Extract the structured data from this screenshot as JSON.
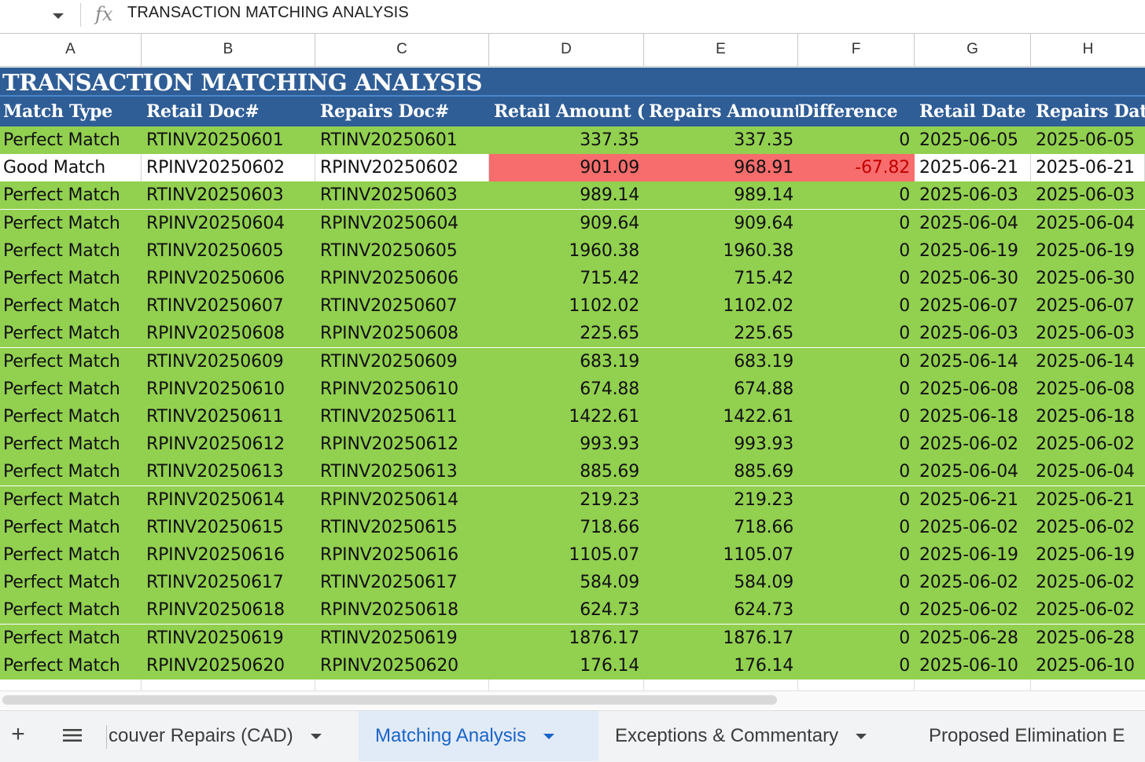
{
  "formula_bar": {
    "formula": "TRANSACTION MATCHING ANALYSIS"
  },
  "column_letters": [
    "A",
    "B",
    "C",
    "D",
    "E",
    "F",
    "G",
    "H"
  ],
  "sheet": {
    "title": "TRANSACTION MATCHING ANALYSIS",
    "headers": [
      "Match Type",
      "Retail Doc#",
      "Repairs Doc#",
      "Retail Amount (",
      "Repairs Amount",
      "Difference",
      "Retail Date",
      "Repairs Date"
    ],
    "rows": [
      {
        "type": "Perfect Match",
        "retail_doc": "RTINV20250601",
        "repairs_doc": "RTINV20250601",
        "retail_amt": "337.35",
        "repairs_amt": "337.35",
        "diff": "0",
        "retail_date": "2025-06-05",
        "repairs_date": "2025-06-05"
      },
      {
        "type": "Good Match",
        "retail_doc": "RPINV20250602",
        "repairs_doc": "RPINV20250602",
        "retail_amt": "901.09",
        "repairs_amt": "968.91",
        "diff": "-67.82",
        "retail_date": "2025-06-21",
        "repairs_date": "2025-06-21"
      },
      {
        "type": "Perfect Match",
        "retail_doc": "RTINV20250603",
        "repairs_doc": "RTINV20250603",
        "retail_amt": "989.14",
        "repairs_amt": "989.14",
        "diff": "0",
        "retail_date": "2025-06-03",
        "repairs_date": "2025-06-03"
      },
      {
        "type": "Perfect Match",
        "retail_doc": "RPINV20250604",
        "repairs_doc": "RPINV20250604",
        "retail_amt": "909.64",
        "repairs_amt": "909.64",
        "diff": "0",
        "retail_date": "2025-06-04",
        "repairs_date": "2025-06-04"
      },
      {
        "type": "Perfect Match",
        "retail_doc": "RTINV20250605",
        "repairs_doc": "RTINV20250605",
        "retail_amt": "1960.38",
        "repairs_amt": "1960.38",
        "diff": "0",
        "retail_date": "2025-06-19",
        "repairs_date": "2025-06-19"
      },
      {
        "type": "Perfect Match",
        "retail_doc": "RPINV20250606",
        "repairs_doc": "RPINV20250606",
        "retail_amt": "715.42",
        "repairs_amt": "715.42",
        "diff": "0",
        "retail_date": "2025-06-30",
        "repairs_date": "2025-06-30"
      },
      {
        "type": "Perfect Match",
        "retail_doc": "RTINV20250607",
        "repairs_doc": "RTINV20250607",
        "retail_amt": "1102.02",
        "repairs_amt": "1102.02",
        "diff": "0",
        "retail_date": "2025-06-07",
        "repairs_date": "2025-06-07"
      },
      {
        "type": "Perfect Match",
        "retail_doc": "RPINV20250608",
        "repairs_doc": "RPINV20250608",
        "retail_amt": "225.65",
        "repairs_amt": "225.65",
        "diff": "0",
        "retail_date": "2025-06-03",
        "repairs_date": "2025-06-03"
      },
      {
        "type": "Perfect Match",
        "retail_doc": "RTINV20250609",
        "repairs_doc": "RTINV20250609",
        "retail_amt": "683.19",
        "repairs_amt": "683.19",
        "diff": "0",
        "retail_date": "2025-06-14",
        "repairs_date": "2025-06-14"
      },
      {
        "type": "Perfect Match",
        "retail_doc": "RPINV20250610",
        "repairs_doc": "RPINV20250610",
        "retail_amt": "674.88",
        "repairs_amt": "674.88",
        "diff": "0",
        "retail_date": "2025-06-08",
        "repairs_date": "2025-06-08"
      },
      {
        "type": "Perfect Match",
        "retail_doc": "RTINV20250611",
        "repairs_doc": "RTINV20250611",
        "retail_amt": "1422.61",
        "repairs_amt": "1422.61",
        "diff": "0",
        "retail_date": "2025-06-18",
        "repairs_date": "2025-06-18"
      },
      {
        "type": "Perfect Match",
        "retail_doc": "RPINV20250612",
        "repairs_doc": "RPINV20250612",
        "retail_amt": "993.93",
        "repairs_amt": "993.93",
        "diff": "0",
        "retail_date": "2025-06-02",
        "repairs_date": "2025-06-02"
      },
      {
        "type": "Perfect Match",
        "retail_doc": "RTINV20250613",
        "repairs_doc": "RTINV20250613",
        "retail_amt": "885.69",
        "repairs_amt": "885.69",
        "diff": "0",
        "retail_date": "2025-06-04",
        "repairs_date": "2025-06-04"
      },
      {
        "type": "Perfect Match",
        "retail_doc": "RPINV20250614",
        "repairs_doc": "RPINV20250614",
        "retail_amt": "219.23",
        "repairs_amt": "219.23",
        "diff": "0",
        "retail_date": "2025-06-21",
        "repairs_date": "2025-06-21"
      },
      {
        "type": "Perfect Match",
        "retail_doc": "RTINV20250615",
        "repairs_doc": "RTINV20250615",
        "retail_amt": "718.66",
        "repairs_amt": "718.66",
        "diff": "0",
        "retail_date": "2025-06-02",
        "repairs_date": "2025-06-02"
      },
      {
        "type": "Perfect Match",
        "retail_doc": "RPINV20250616",
        "repairs_doc": "RPINV20250616",
        "retail_amt": "1105.07",
        "repairs_amt": "1105.07",
        "diff": "0",
        "retail_date": "2025-06-19",
        "repairs_date": "2025-06-19"
      },
      {
        "type": "Perfect Match",
        "retail_doc": "RTINV20250617",
        "repairs_doc": "RTINV20250617",
        "retail_amt": "584.09",
        "repairs_amt": "584.09",
        "diff": "0",
        "retail_date": "2025-06-02",
        "repairs_date": "2025-06-02"
      },
      {
        "type": "Perfect Match",
        "retail_doc": "RPINV20250618",
        "repairs_doc": "RPINV20250618",
        "retail_amt": "624.73",
        "repairs_amt": "624.73",
        "diff": "0",
        "retail_date": "2025-06-02",
        "repairs_date": "2025-06-02"
      },
      {
        "type": "Perfect Match",
        "retail_doc": "RTINV20250619",
        "repairs_doc": "RTINV20250619",
        "retail_amt": "1876.17",
        "repairs_amt": "1876.17",
        "diff": "0",
        "retail_date": "2025-06-28",
        "repairs_date": "2025-06-28"
      },
      {
        "type": "Perfect Match",
        "retail_doc": "RPINV20250620",
        "repairs_doc": "RPINV20250620",
        "retail_amt": "176.14",
        "repairs_amt": "176.14",
        "diff": "0",
        "retail_date": "2025-06-10",
        "repairs_date": "2025-06-10"
      }
    ]
  },
  "colors": {
    "title_bg": "#2f5d96",
    "perfect_match_bg": "#92d050",
    "mismatch_highlight": "#f76c6c",
    "active_tab_text": "#1a63c8"
  },
  "tabs": {
    "add_icon": "+",
    "items": [
      {
        "label": "couver Repairs (CAD)",
        "active": false
      },
      {
        "label": "Matching Analysis",
        "active": true
      },
      {
        "label": "Exceptions & Commentary",
        "active": false
      },
      {
        "label": "Proposed Elimination E",
        "active": false
      }
    ]
  }
}
